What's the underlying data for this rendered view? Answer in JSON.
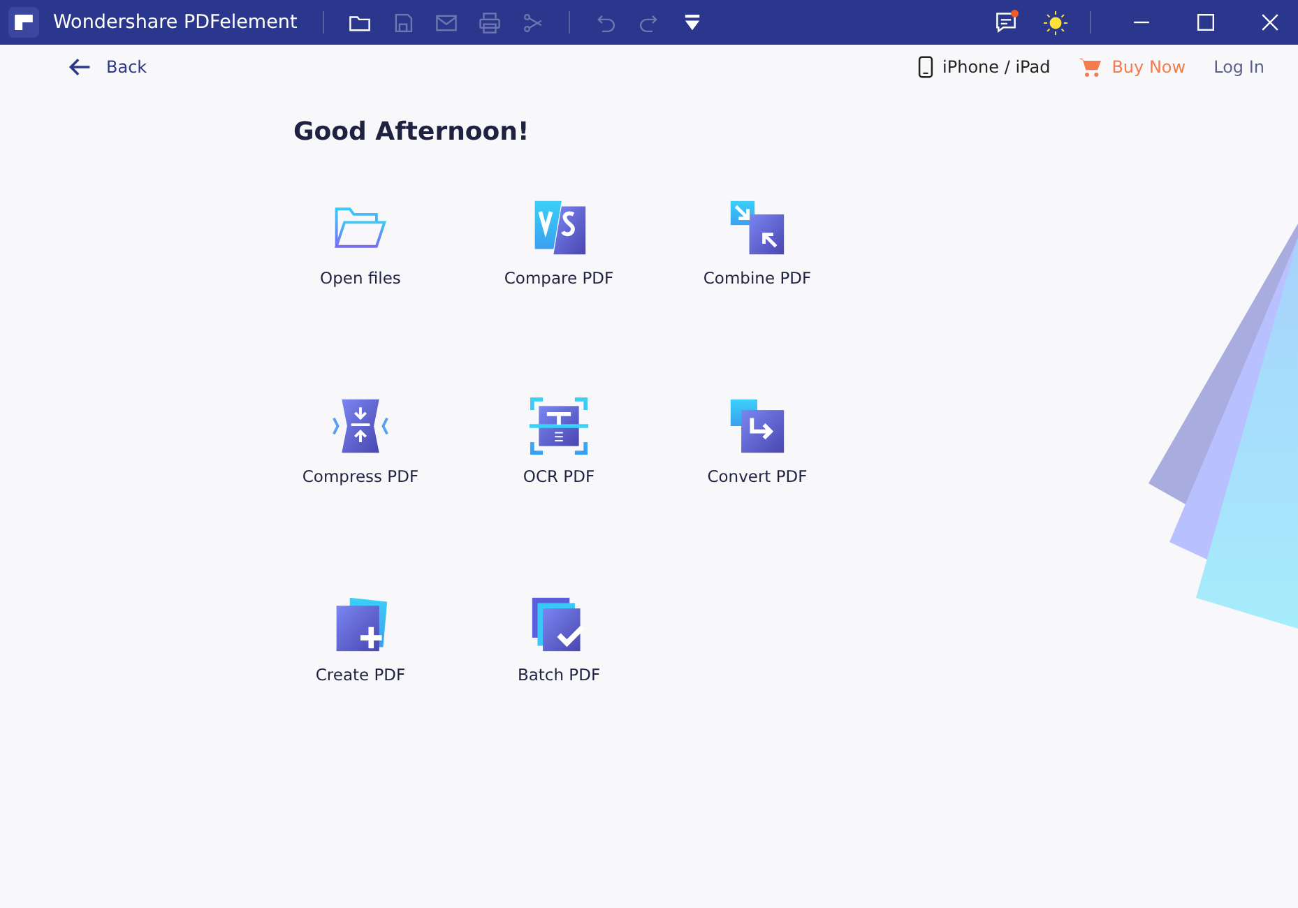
{
  "window": {
    "title": "Wondershare PDFelement"
  },
  "toolbar": [
    {
      "kind": "folder",
      "disabled": false
    },
    {
      "kind": "save",
      "disabled": true
    },
    {
      "kind": "mail",
      "disabled": true
    },
    {
      "kind": "print",
      "disabled": true
    },
    {
      "kind": "scissors",
      "disabled": true
    },
    {
      "kind": "undo",
      "disabled": true
    },
    {
      "kind": "redo",
      "disabled": true
    },
    {
      "kind": "quick-access",
      "disabled": false
    }
  ],
  "notification": {
    "unread": true
  },
  "nav": {
    "back": "Back",
    "device": "iPhone / iPad",
    "buy": "Buy Now",
    "login": "Log In"
  },
  "greeting": "Good Afternoon!",
  "tools": [
    {
      "label": "Open files",
      "kind": "open"
    },
    {
      "label": "Compare PDF",
      "kind": "compare"
    },
    {
      "label": "Combine PDF",
      "kind": "combine"
    },
    {
      "label": "Compress PDF",
      "kind": "compress"
    },
    {
      "label": "OCR PDF",
      "kind": "ocr"
    },
    {
      "label": "Convert PDF",
      "kind": "convert"
    },
    {
      "label": "Create PDF",
      "kind": "create"
    },
    {
      "label": "Batch PDF",
      "kind": "batch"
    }
  ]
}
